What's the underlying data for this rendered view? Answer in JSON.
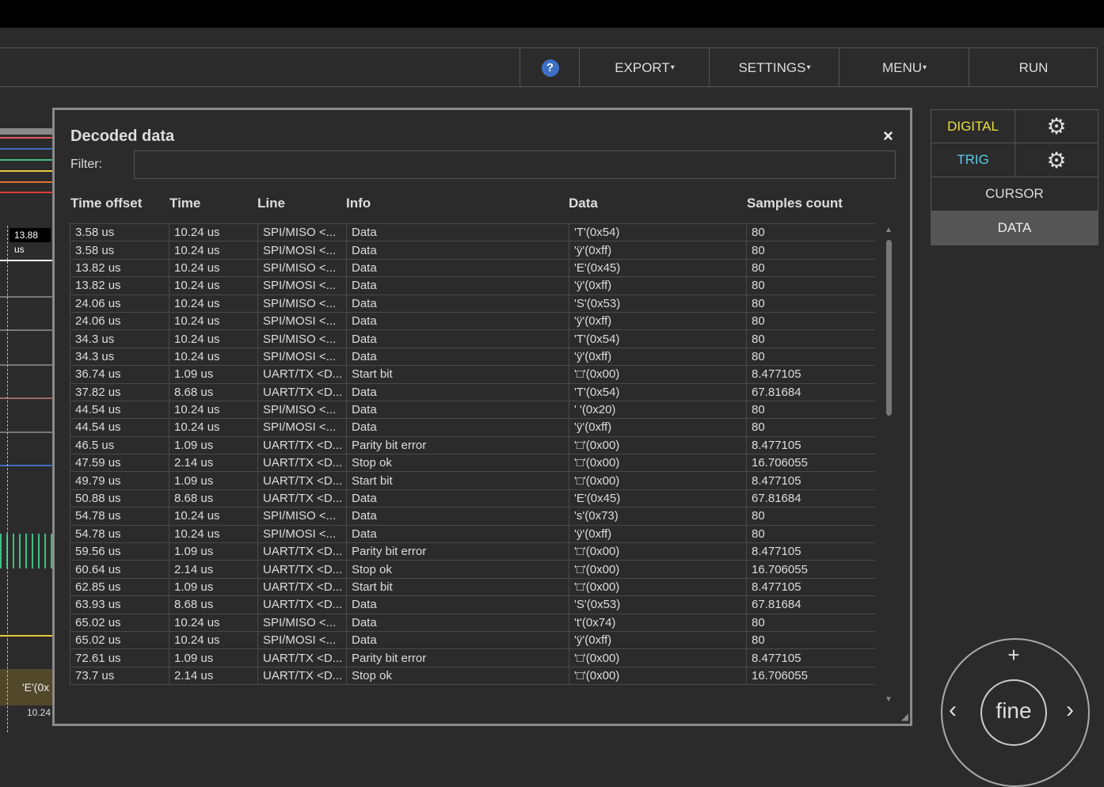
{
  "toolbar": {
    "help": "?",
    "export": "EXPORT",
    "settings": "SETTINGS",
    "menu": "MENU",
    "run": "RUN"
  },
  "right_panel": {
    "digital": "DIGITAL",
    "trig": "TRIG",
    "cursor": "CURSOR",
    "data": "DATA",
    "digital_color": "#e8e03c",
    "trig_color": "#5ec8e8"
  },
  "waveform": {
    "cursor_label": "13.88 us",
    "annotation": "'E'(0x",
    "time_label": "10.24"
  },
  "dial": {
    "label": "fine",
    "plus": "+",
    "left": "‹",
    "right": "›"
  },
  "modal": {
    "title": "Decoded data",
    "close": "×",
    "filter_label": "Filter:",
    "filter_value": "",
    "columns": [
      "Time offset",
      "Time",
      "Line",
      "Info",
      "Data",
      "Samples count"
    ],
    "rows": [
      [
        "3.58 us",
        "10.24 us",
        "SPI/MISO <...",
        "Data",
        "'T'(0x54)",
        "80"
      ],
      [
        "3.58 us",
        "10.24 us",
        "SPI/MOSI <...",
        "Data",
        "'ÿ'(0xff)",
        "80"
      ],
      [
        "13.82 us",
        "10.24 us",
        "SPI/MISO <...",
        "Data",
        "'E'(0x45)",
        "80"
      ],
      [
        "13.82 us",
        "10.24 us",
        "SPI/MOSI <...",
        "Data",
        "'ÿ'(0xff)",
        "80"
      ],
      [
        "24.06 us",
        "10.24 us",
        "SPI/MISO <...",
        "Data",
        "'S'(0x53)",
        "80"
      ],
      [
        "24.06 us",
        "10.24 us",
        "SPI/MOSI <...",
        "Data",
        "'ÿ'(0xff)",
        "80"
      ],
      [
        "34.3 us",
        "10.24 us",
        "SPI/MISO <...",
        "Data",
        "'T'(0x54)",
        "80"
      ],
      [
        "34.3 us",
        "10.24 us",
        "SPI/MOSI <...",
        "Data",
        "'ÿ'(0xff)",
        "80"
      ],
      [
        "36.74 us",
        "1.09 us",
        "UART/TX <D...",
        "Start bit",
        "'□'(0x00)",
        "8.477105"
      ],
      [
        "37.82 us",
        "8.68 us",
        "UART/TX <D...",
        "Data",
        "'T'(0x54)",
        "67.81684"
      ],
      [
        "44.54 us",
        "10.24 us",
        "SPI/MISO <...",
        "Data",
        "' '(0x20)",
        "80"
      ],
      [
        "44.54 us",
        "10.24 us",
        "SPI/MOSI <...",
        "Data",
        "'ÿ'(0xff)",
        "80"
      ],
      [
        "46.5 us",
        "1.09 us",
        "UART/TX <D...",
        "Parity bit error",
        "'□'(0x00)",
        "8.477105"
      ],
      [
        "47.59 us",
        "2.14 us",
        "UART/TX <D...",
        "Stop ok",
        "'□'(0x00)",
        "16.706055"
      ],
      [
        "49.79 us",
        "1.09 us",
        "UART/TX <D...",
        "Start bit",
        "'□'(0x00)",
        "8.477105"
      ],
      [
        "50.88 us",
        "8.68 us",
        "UART/TX <D...",
        "Data",
        "'E'(0x45)",
        "67.81684"
      ],
      [
        "54.78 us",
        "10.24 us",
        "SPI/MISO <...",
        "Data",
        "'s'(0x73)",
        "80"
      ],
      [
        "54.78 us",
        "10.24 us",
        "SPI/MOSI <...",
        "Data",
        "'ÿ'(0xff)",
        "80"
      ],
      [
        "59.56 us",
        "1.09 us",
        "UART/TX <D...",
        "Parity bit error",
        "'□'(0x00)",
        "8.477105"
      ],
      [
        "60.64 us",
        "2.14 us",
        "UART/TX <D...",
        "Stop ok",
        "'□'(0x00)",
        "16.706055"
      ],
      [
        "62.85 us",
        "1.09 us",
        "UART/TX <D...",
        "Start bit",
        "'□'(0x00)",
        "8.477105"
      ],
      [
        "63.93 us",
        "8.68 us",
        "UART/TX <D...",
        "Data",
        "'S'(0x53)",
        "67.81684"
      ],
      [
        "65.02 us",
        "10.24 us",
        "SPI/MISO <...",
        "Data",
        "'t'(0x74)",
        "80"
      ],
      [
        "65.02 us",
        "10.24 us",
        "SPI/MOSI <...",
        "Data",
        "'ÿ'(0xff)",
        "80"
      ],
      [
        "72.61 us",
        "1.09 us",
        "UART/TX <D...",
        "Parity bit error",
        "'□'(0x00)",
        "8.477105"
      ],
      [
        "73.7 us",
        "2.14 us",
        "UART/TX <D...",
        "Stop ok",
        "'□'(0x00)",
        "16.706055"
      ]
    ]
  },
  "trace_colors": [
    "#c8c8c8",
    "#e05a5a",
    "#3d6fc4",
    "#3fbf7f",
    "#e8c83c",
    "#e07030",
    "#e03c3c"
  ]
}
